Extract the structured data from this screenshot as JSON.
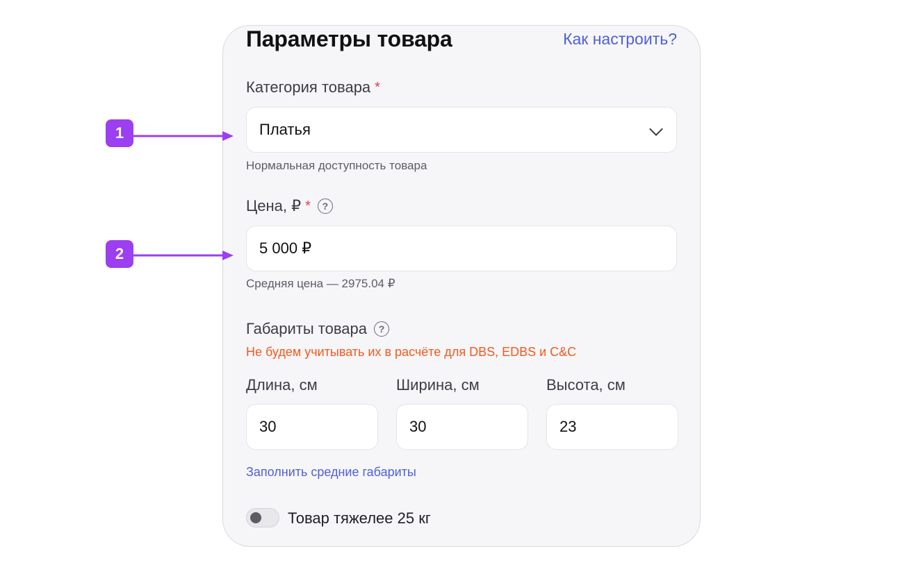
{
  "panel": {
    "title": "Параметры товара",
    "help_link": "Как настроить?"
  },
  "category": {
    "label": "Категория товара",
    "required_mark": "*",
    "value": "Платья",
    "hint": "Нормальная доступность товара"
  },
  "price": {
    "label": "Цена, ₽",
    "required_mark": "*",
    "value": "5 000 ₽",
    "hint": "Средняя цена — 2975.04 ₽"
  },
  "dimensions": {
    "label": "Габариты товара",
    "warning": "Не будем учитывать их в расчёте для DBS, EDBS и C&C",
    "length": {
      "label": "Длина, см",
      "value": "30"
    },
    "width": {
      "label": "Ширина, см",
      "value": "30"
    },
    "height": {
      "label": "Высота, см",
      "value": "23"
    },
    "fill_link": "Заполнить средние габариты"
  },
  "heavy_toggle": {
    "label": "Товар тяжелее 25 кг",
    "checked": false
  },
  "markers": {
    "first": "1",
    "second": "2"
  },
  "colors": {
    "accent_link": "#4f5fd6",
    "warning": "#f05a1d",
    "required": "#e63950",
    "marker": "#9b3ff0"
  },
  "icons": {
    "dropdown": "chevron-down-icon",
    "help": "question-circle-icon"
  }
}
